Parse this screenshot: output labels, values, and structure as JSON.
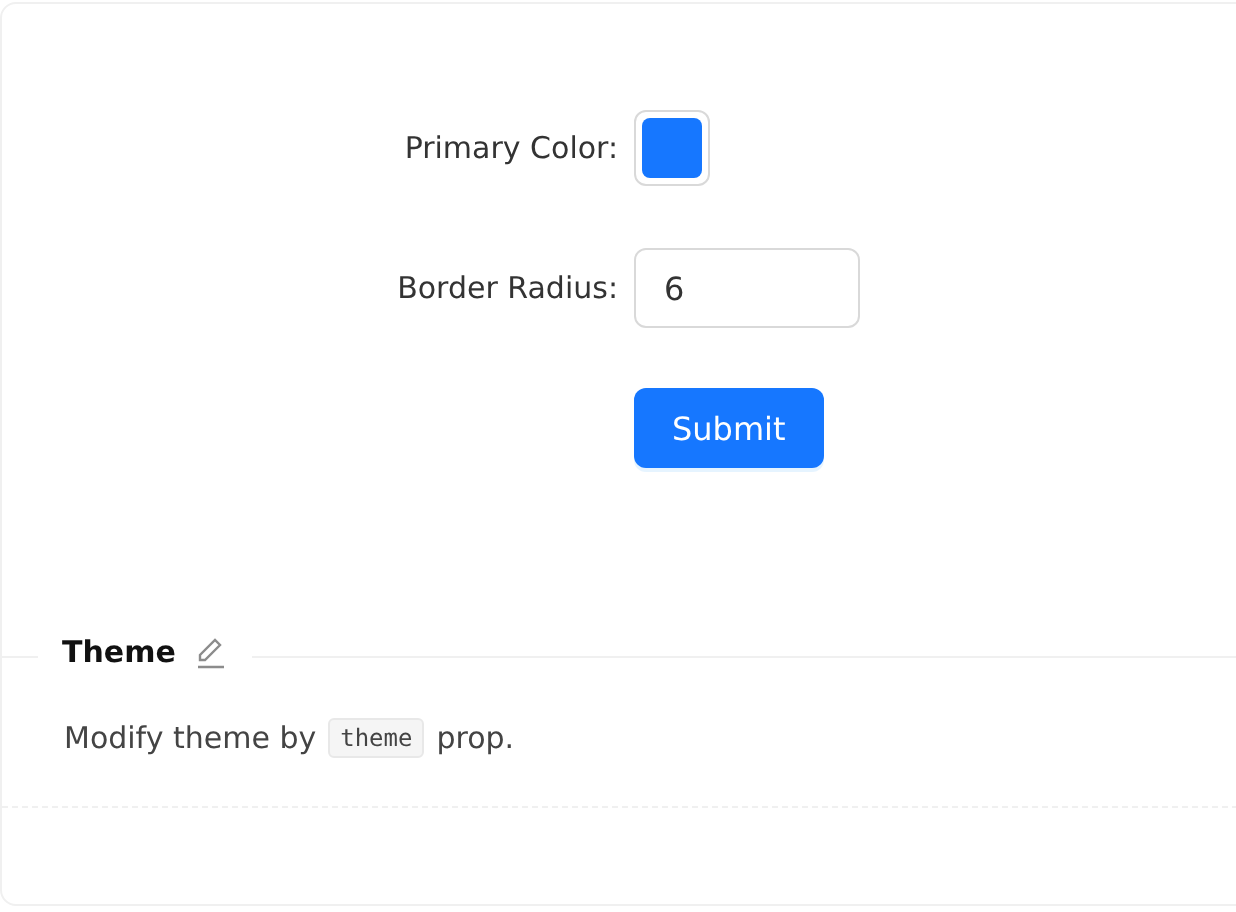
{
  "form": {
    "fields": [
      {
        "kind": "color",
        "label": "Primary Color",
        "separator": ":",
        "color": "#1677ff"
      },
      {
        "kind": "number",
        "label": "Border Radius",
        "separator": ":",
        "value": "6"
      }
    ],
    "submit": "Submit"
  },
  "meta": {
    "title": "Theme",
    "description": {
      "before": "Modify theme by",
      "code": "theme",
      "after": "prop."
    }
  }
}
